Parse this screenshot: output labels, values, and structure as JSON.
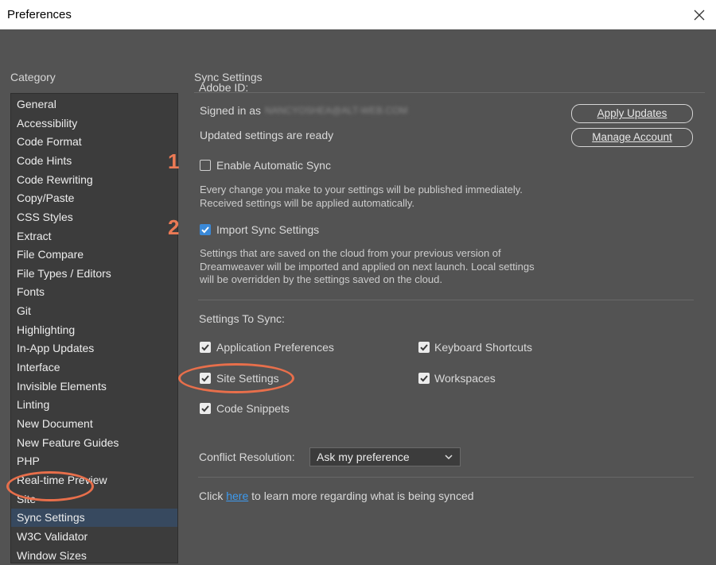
{
  "window": {
    "title": "Preferences"
  },
  "category": {
    "label": "Category",
    "items": [
      "General",
      "Accessibility",
      "Code Format",
      "Code Hints",
      "Code Rewriting",
      "Copy/Paste",
      "CSS Styles",
      "Extract",
      "File Compare",
      "File Types / Editors",
      "Fonts",
      "Git",
      "Highlighting",
      "In-App Updates",
      "Interface",
      "Invisible Elements",
      "Linting",
      "New Document",
      "New Feature Guides",
      "PHP",
      "Real-time Preview",
      "Site",
      "Sync Settings",
      "W3C Validator",
      "Window Sizes"
    ],
    "selected": "Sync Settings"
  },
  "sync": {
    "title": "Sync Settings",
    "adobe_id_label": "Adobe ID:",
    "signed_in_label": "Signed in as",
    "signed_in_email": "NANCYOSHEA@ALT-WEB.COM",
    "updated_label": "Updated settings are ready",
    "apply_updates": "Apply Updates",
    "manage_account": "Manage Account",
    "enable_auto_sync": {
      "label": "Enable Automatic Sync",
      "checked": false
    },
    "auto_desc": [
      "Every change you make to your settings will be published immediately.",
      "Received settings will be applied automatically."
    ],
    "import_sync": {
      "label": "Import Sync Settings",
      "checked": true
    },
    "import_desc": [
      "Settings that are saved on the cloud from your previous version of",
      "Dreamweaver will be imported and applied on next launch. Local settings",
      "will be overridden by the settings saved on the cloud."
    ],
    "to_sync_label": "Settings To Sync:",
    "options": {
      "app_prefs": {
        "label": "Application Preferences",
        "checked": true
      },
      "keyboard": {
        "label": "Keyboard Shortcuts",
        "checked": true
      },
      "site_settings": {
        "label": "Site Settings",
        "checked": true
      },
      "workspaces": {
        "label": "Workspaces",
        "checked": true
      },
      "code_snippets": {
        "label": "Code Snippets",
        "checked": true
      }
    },
    "conflict_label": "Conflict Resolution:",
    "conflict_value": "Ask my preference",
    "footer_before": "Click",
    "footer_link": "here",
    "footer_after": "to learn more regarding what is being synced"
  },
  "annotations": {
    "step1": "1",
    "step2": "2",
    "color": "#e86f4b"
  }
}
